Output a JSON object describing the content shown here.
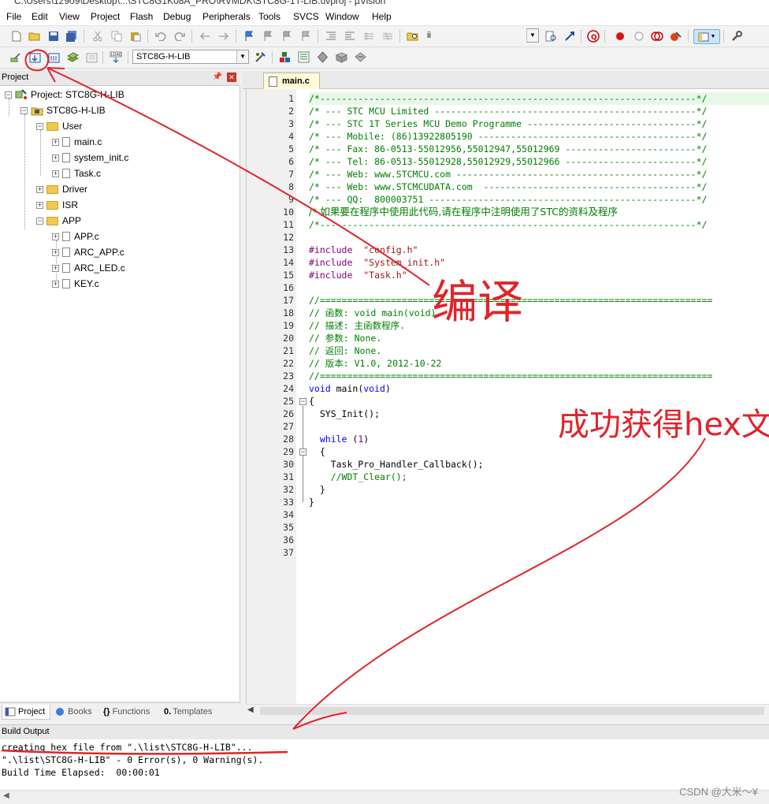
{
  "window": {
    "title": "C:\\Users\\12909\\Desktop\\...\\STC8G1K08A_PRO\\RVMDK\\STC8G-1T-LIB.uvproj - µVision"
  },
  "menu": [
    "File",
    "Edit",
    "View",
    "Project",
    "Flash",
    "Debug",
    "Peripherals",
    "Tools",
    "SVCS",
    "Window",
    "Help"
  ],
  "toolbar": {
    "find_value": "ii",
    "target": "STC8G-H-LIB"
  },
  "project_panel": {
    "title": "Project",
    "root": "Project: STC8G-H-LIB",
    "target": "STC8G-H-LIB",
    "groups": {
      "user": "User",
      "driver": "Driver",
      "isr": "ISR",
      "app": "APP"
    },
    "user_files": [
      "main.c",
      "system_init.c",
      "Task.c"
    ],
    "app_files": [
      "APP.c",
      "ARC_APP.c",
      "ARC_LED.c",
      "KEY.c"
    ],
    "tabs": [
      "Project",
      "Books",
      "Functions",
      "Templates"
    ]
  },
  "editor": {
    "tab": "main.c",
    "line_numbers": [
      "1",
      "2",
      "3",
      "4",
      "5",
      "6",
      "7",
      "8",
      "9",
      "10",
      "11",
      "12",
      "13",
      "14",
      "15",
      "16",
      "17",
      "18",
      "19",
      "20",
      "21",
      "22",
      "23",
      "24",
      "25",
      "26",
      "27",
      "28",
      "29",
      "30",
      "31",
      "32",
      "33",
      "34",
      "35",
      "36",
      "37"
    ],
    "lines": {
      "l1": "/*---------------------------------------------------------------------*/",
      "l2": "/* --- STC MCU Limited ------------------------------------------------*/",
      "l3": "/* --- STC 1T Series MCU Demo Programme -------------------------------*/",
      "l4": "/* --- Mobile: (86)13922805190 ----------------------------------------*/",
      "l5": "/* --- Fax: 86-0513-55012956,55012947,55012969 ------------------------*/",
      "l6": "/* --- Tel: 86-0513-55012928,55012929,55012966 ------------------------*/",
      "l7": "/* --- Web: www.STCMCU.com --------------------------------------------*/",
      "l8": "/* --- Web: www.STCMCUDATA.com  ---------------------------------------*/",
      "l9": "/* --- QQ:  800003751 -------------------------------------------------*/",
      "l10": "/* 如果要在程序中使用此代码,请在程序中注明使用了STC的资料及程序",
      "l11": "/*---------------------------------------------------------------------*/",
      "l13_kw": "#include",
      "l13_str": "\"config.h\"",
      "l14_kw": "#include",
      "l14_str": "\"System_init.h\"",
      "l15_kw": "#include",
      "l15_str": "\"Task.h\"",
      "l17": "//========================================================================",
      "l18": "// 函数: void main(void)",
      "l19": "// 描述: 主函数程序.",
      "l20": "// 参数: None.",
      "l21": "// 返回: None.",
      "l22": "// 版本: V1.0, 2012-10-22",
      "l23": "//========================================================================",
      "l24_kw1": "void",
      "l24_mid": " main(",
      "l24_kw2": "void",
      "l24_end": ")",
      "l25": "{",
      "l26": "  SYS_Init();",
      "l28_kw": "  while",
      "l28_rest": " (",
      "l28_num": "1",
      "l28_end": ")",
      "l29": "  {",
      "l30": "    Task_Pro_Handler_Callback();",
      "l31": "    //WDT_Clear();",
      "l32": "  }",
      "l33": "}"
    }
  },
  "build_output": {
    "title": "Build Output",
    "lines": [
      "creating hex file from \".\\list\\STC8G-H-LIB\"...",
      "\".\\list\\STC8G-H-LIB\" - 0 Error(s), 0 Warning(s).",
      "Build Time Elapsed:  00:00:01"
    ]
  },
  "annotations": {
    "compile": "编译",
    "success": "成功获得hex文"
  },
  "watermark": "CSDN @大米～¥",
  "colors": {
    "annotation": "#e0242a",
    "comment": "#008000",
    "keyword": "#0000ff",
    "string": "#a31515"
  }
}
